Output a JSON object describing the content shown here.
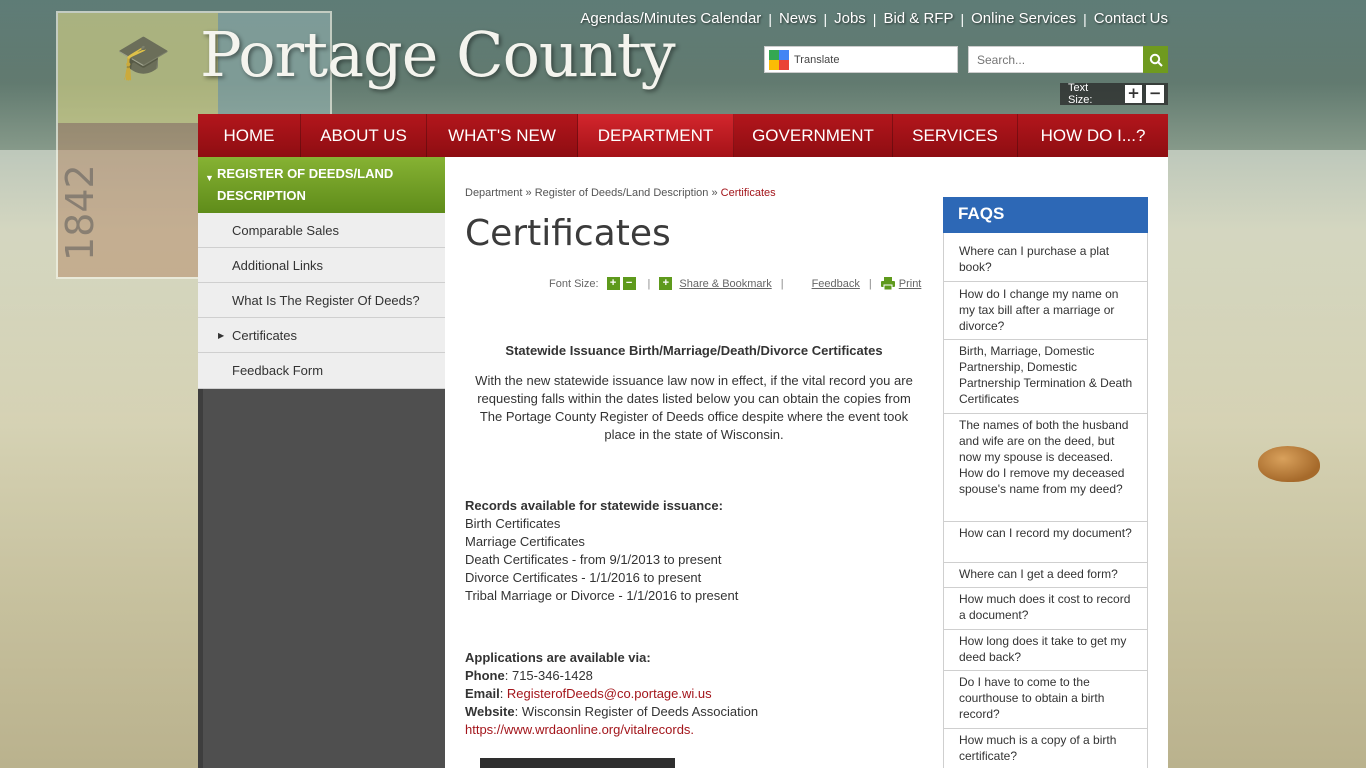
{
  "colors": {
    "nav_red": "#a3151b",
    "sidebar_green": "#6f9a1f",
    "faq_blue": "#2d68b6"
  },
  "header": {
    "site_title": "Portage County",
    "seal_year": "1842",
    "utility_links": [
      "Agendas/Minutes Calendar",
      "News",
      "Jobs",
      "Bid & RFP",
      "Online Services",
      "Contact Us"
    ],
    "translate_label": "Translate",
    "search_placeholder": "Search...",
    "search_icon": "search-icon",
    "text_size_label": "Text Size:",
    "text_size_plus": "+",
    "text_size_minus": "−"
  },
  "main_nav": {
    "items": [
      {
        "label": "Home",
        "active": false
      },
      {
        "label": "About Us",
        "active": false
      },
      {
        "label": "What's New",
        "active": false
      },
      {
        "label": "Department",
        "active": true
      },
      {
        "label": "Government",
        "active": false
      },
      {
        "label": "Services",
        "active": false
      },
      {
        "label": "How Do I...?",
        "active": false
      }
    ]
  },
  "sidebar": {
    "heading": "Register of Deeds/Land Description",
    "items": [
      {
        "label": "Comparable Sales"
      },
      {
        "label": "Additional Links"
      },
      {
        "label": "What Is The Register Of Deeds?"
      },
      {
        "label": "Certificates",
        "has_arrow": true
      },
      {
        "label": "Feedback Form"
      }
    ]
  },
  "breadcrumb": {
    "items": [
      "Department",
      "Register of Deeds/Land Description"
    ],
    "separator": "»",
    "current": "Certificates"
  },
  "page": {
    "title": "Certificates",
    "tools": {
      "font_size_label": "Font Size:",
      "share_label": "Share & Bookmark",
      "feedback_label": "Feedback",
      "print_label": "Print"
    },
    "section_heading": "Statewide Issuance Birth/Marriage/Death/Divorce Certificates",
    "intro": "With the new statewide issuance law now in effect, if the vital record you are requesting falls within the dates listed below you can obtain the copies from The Portage County Register of Deeds office despite where the event took place in the state of Wisconsin.",
    "records_heading": "Records available for statewide issuance:",
    "records": [
      "Birth Certificates",
      "Marriage Certificates",
      "Death Certificates - from 9/1/2013 to present",
      "Divorce Certificates - 1/1/2016 to present",
      "Tribal Marriage or Divorce - 1/1/2016 to present"
    ],
    "applications_heading": "Applications are available via:",
    "phone_label": "Phone",
    "phone": ": 715-346-1428",
    "email_label": "Email",
    "email_sep": ": ",
    "email": "RegisterofDeeds@co.portage.wi.us",
    "website_label": "Website",
    "website_text": ": Wisconsin Register of Deeds Association",
    "website_url": "https://www.wrdaonline.org/vitalrecords."
  },
  "faqs": {
    "heading": "FAQS",
    "items": [
      "Where can I purchase a plat book?",
      "How do I change my name on my tax bill after a marriage or divorce?",
      "Birth, Marriage, Domestic Partnership, Domestic Partnership Termination & Death Certificates",
      "The names of both the husband and wife are on the deed, but now my spouse is deceased. How do I remove my deceased spouse's name from my deed?",
      "How can I record my document?",
      "Where can I get a deed form?",
      "How much does it cost to record a document?",
      "How long does it take to get my deed back?",
      "Do I have to come to the courthouse to obtain a birth record?",
      "How much is a copy of a birth certificate?"
    ]
  }
}
